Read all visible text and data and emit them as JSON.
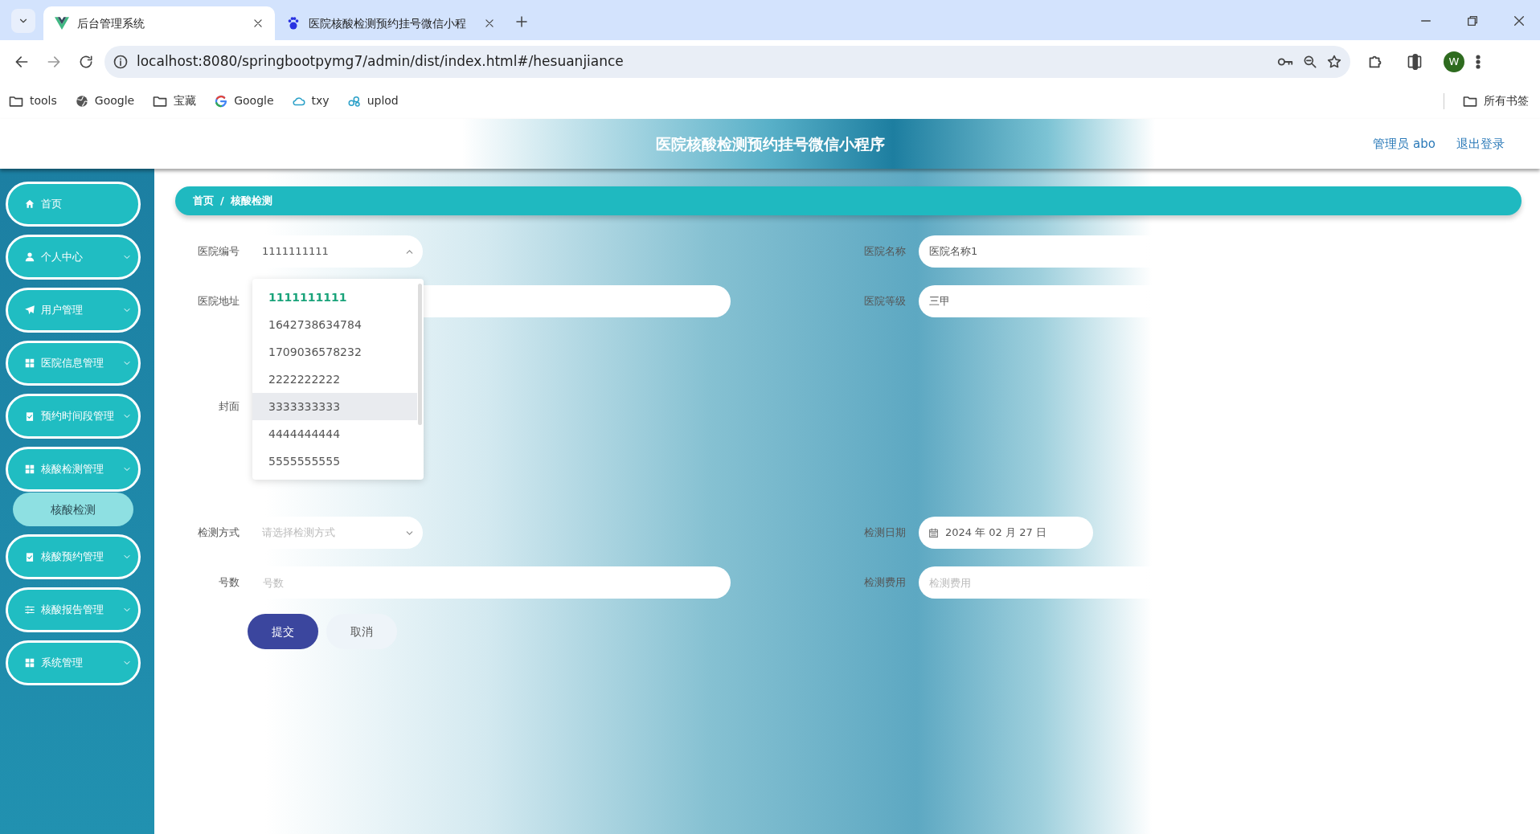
{
  "browser": {
    "tabs": [
      {
        "title": "后台管理系统",
        "selected": true
      },
      {
        "title": "医院核酸检测预约挂号微信小程",
        "selected": false
      }
    ],
    "url": "localhost:8080/springbootpymg7/admin/dist/index.html#/hesuanjiance",
    "profile": "W",
    "bookmarks": [
      {
        "label": "tools",
        "kind": "folder"
      },
      {
        "label": "Google",
        "kind": "site"
      },
      {
        "label": "宝藏",
        "kind": "folder"
      },
      {
        "label": "Google",
        "kind": "site"
      },
      {
        "label": "txy",
        "kind": "site"
      },
      {
        "label": "uplod",
        "kind": "site"
      }
    ],
    "all_bookmarks": "所有书签"
  },
  "header": {
    "title": "医院核酸检测预约挂号微信小程序",
    "user": "管理员 abo",
    "logout": "退出登录"
  },
  "sidebar": {
    "items": [
      {
        "label": "首页",
        "kind": "link"
      },
      {
        "label": "个人中心",
        "kind": "menu"
      },
      {
        "label": "用户管理",
        "kind": "menu"
      },
      {
        "label": "医院信息管理",
        "kind": "menu"
      },
      {
        "label": "预约时间段管理",
        "kind": "menu"
      },
      {
        "label": "核酸检测管理",
        "kind": "menu",
        "children": [
          {
            "label": "核酸检测",
            "selected": true
          }
        ]
      },
      {
        "label": "核酸预约管理",
        "kind": "menu"
      },
      {
        "label": "核酸报告管理",
        "kind": "menu"
      },
      {
        "label": "系统管理",
        "kind": "menu"
      }
    ]
  },
  "breadcrumb": {
    "items": [
      "首页",
      "核酸检测"
    ],
    "separator": "/"
  },
  "form": {
    "rows": [
      [
        {
          "label": "医院编号",
          "kind": "select",
          "value": "1111111111",
          "expanded": true
        },
        {
          "label": "医院名称",
          "kind": "input",
          "value": "医院名称1"
        }
      ],
      [
        {
          "label": "医院地址",
          "kind": "input"
        },
        {
          "label": "医院等级",
          "kind": "input",
          "value": "三甲"
        }
      ],
      [
        {
          "label": "封面",
          "kind": "upload"
        }
      ],
      [
        {
          "label": "检测方式",
          "kind": "select",
          "placeholder": "请选择检测方式",
          "expanded": false
        },
        {
          "label": "检测日期",
          "kind": "date",
          "value": "2024 年 02 月 27 日"
        }
      ],
      [
        {
          "label": "号数",
          "kind": "input",
          "placeholder": "号数"
        },
        {
          "label": "检测费用",
          "kind": "input",
          "placeholder": "检测费用"
        }
      ]
    ],
    "dropdown": {
      "options": [
        {
          "label": "1111111111",
          "selected": true,
          "hovered": false
        },
        {
          "label": "1642738634784",
          "selected": false,
          "hovered": false
        },
        {
          "label": "1709036578232",
          "selected": false,
          "hovered": false
        },
        {
          "label": "2222222222",
          "selected": false,
          "hovered": false
        },
        {
          "label": "3333333333",
          "selected": false,
          "hovered": true
        },
        {
          "label": "4444444444",
          "selected": false,
          "hovered": false
        },
        {
          "label": "5555555555",
          "selected": false,
          "hovered": false
        }
      ]
    },
    "buttons": [
      {
        "label": "提交",
        "kind": "primary"
      },
      {
        "label": "取消",
        "kind": "secondary"
      }
    ]
  }
}
